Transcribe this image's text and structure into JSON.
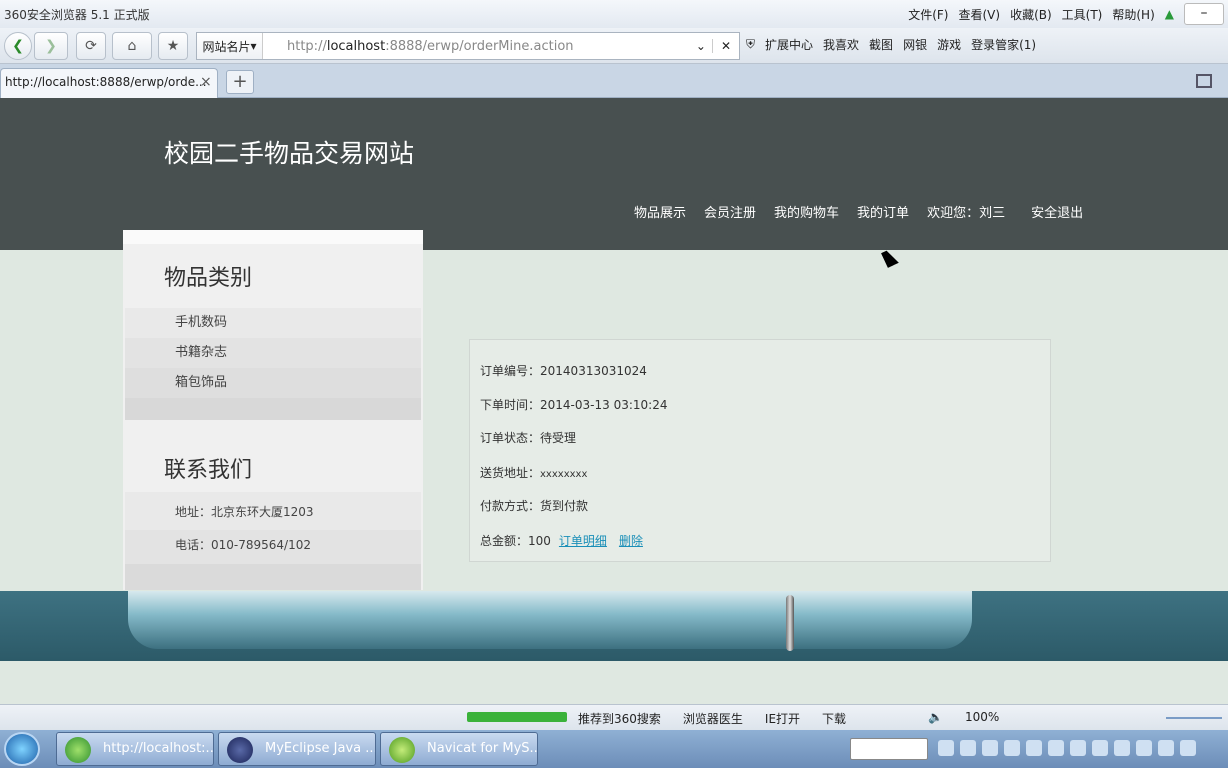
{
  "browser": {
    "title": "360安全浏览器 5.1 正式版",
    "menu": [
      "文件(F)",
      "查看(V)",
      "收藏(B)",
      "工具(T)",
      "帮助(H)"
    ],
    "minimize": "–",
    "site_name_button": "网站名片",
    "address_prefix": "http://",
    "address_host": "localhost",
    "address_rest": ":8888/erwp/orderMine.action",
    "toolbar_items": [
      "扩展中心",
      "我喜欢",
      "截图",
      "网银",
      "游戏",
      "登录管家(1)"
    ],
    "tab_label": "http://localhost:8888/erwp/orde...",
    "tab_close": "×",
    "new_tab": "+"
  },
  "site": {
    "title": "校园二手物品交易网站",
    "nav": [
      "物品展示",
      "会员注册",
      "我的购物车",
      "我的订单",
      "欢迎您：刘三",
      "安全退出"
    ]
  },
  "sidebar": {
    "category_heading": "物品类别",
    "categories": [
      "手机数码",
      "书籍杂志",
      "箱包饰品"
    ],
    "contact_heading": "联系我们",
    "address": "地址：北京东环大厦1203",
    "phone": "电话：010-789564/102"
  },
  "order": {
    "number_label": "订单编号：",
    "number": "20140313031024",
    "time_label": "下单时间：",
    "time": "2014-03-13 03:10:24",
    "status_label": "订单状态：",
    "status": "待受理",
    "address_label": "送货地址：",
    "address": "xxxxxxxx",
    "payment_label": "付款方式：",
    "payment": "货到付款",
    "total_label": "总金额：",
    "total": "100",
    "detail_link": "订单明细",
    "delete_link": "删除"
  },
  "statusbar": {
    "items": [
      "推荐到360搜索",
      "浏览器医生",
      "IE打开",
      "下载",
      "100%"
    ]
  },
  "taskbar": {
    "tasks": [
      "http://localhost:...",
      "MyEclipse Java ...",
      "Navicat for MyS..."
    ]
  },
  "colors": {
    "header_bg": "#485050",
    "page_bg": "#dfe8e1",
    "link": "#1a8fb8",
    "footer": "#3e7282"
  }
}
